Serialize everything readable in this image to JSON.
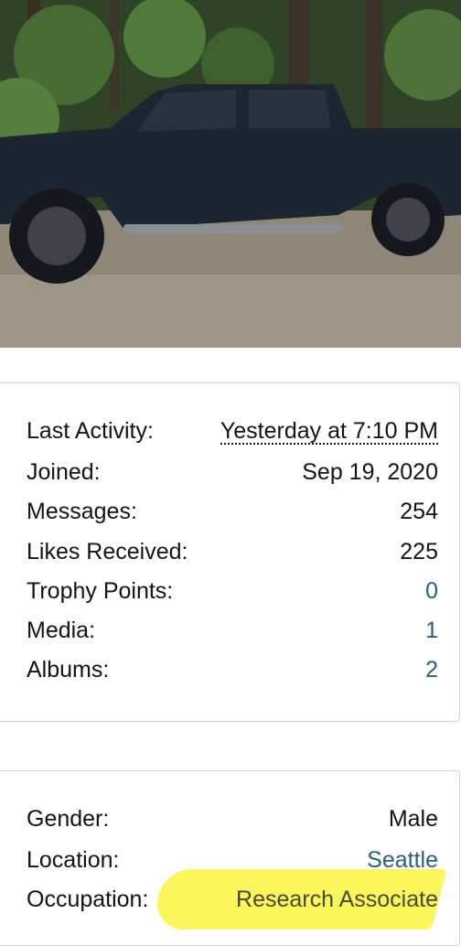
{
  "profile_stats": [
    {
      "label": "Last Activity:",
      "value": "Yesterday at 7:10 PM"
    },
    {
      "label": "Joined:",
      "value": "Sep 19, 2020"
    },
    {
      "label": "Messages:",
      "value": "254"
    },
    {
      "label": "Likes Received:",
      "value": "225"
    },
    {
      "label": "Trophy Points:",
      "value": "0"
    },
    {
      "label": "Media:",
      "value": "1"
    },
    {
      "label": "Albums:",
      "value": "2"
    }
  ],
  "profile_info": [
    {
      "label": "Gender:",
      "value": "Male"
    },
    {
      "label": "Location:",
      "value": "Seattle"
    },
    {
      "label": "Occupation:",
      "value": "Research Associate"
    }
  ],
  "colors": {
    "link": "#2b5e7f",
    "card_border": "#c6dbe0",
    "highlight": "#fbf54a"
  },
  "icons": {
    "photo": "truck-photo"
  }
}
